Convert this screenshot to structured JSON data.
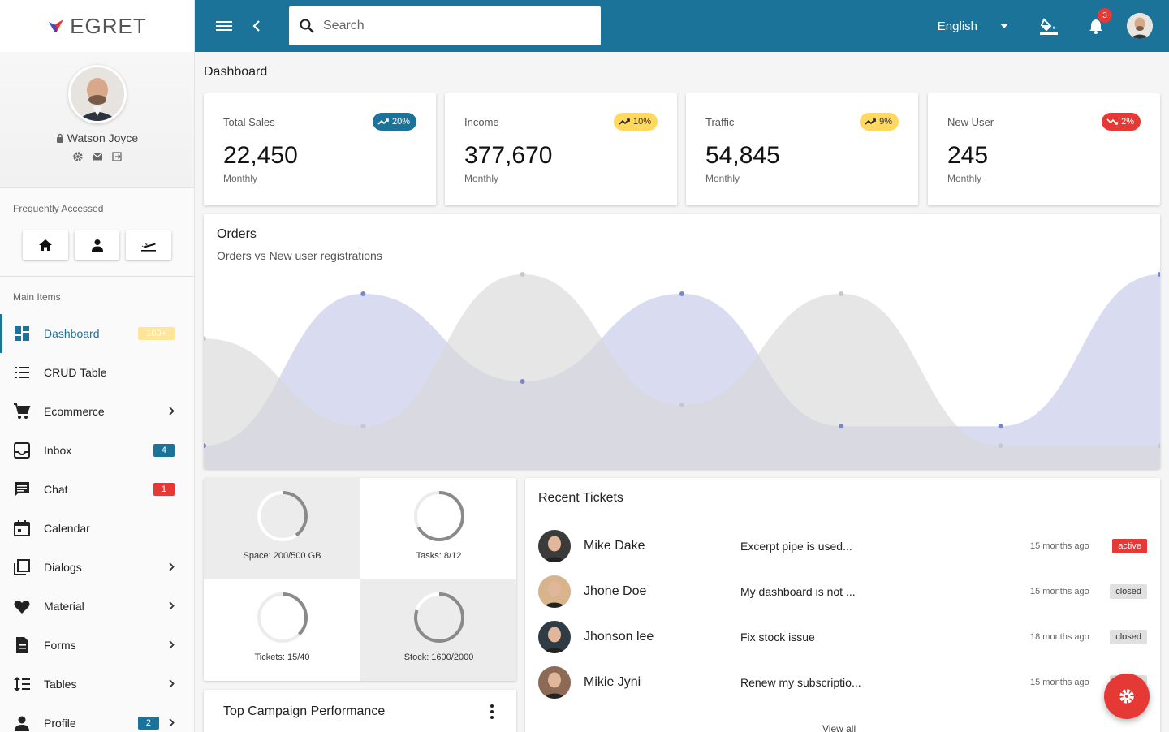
{
  "brand": {
    "name": "EGRET",
    "logo_icon": "egret-logo-icon"
  },
  "user": {
    "name": "Watson Joyce",
    "lock_icon": "lock-icon",
    "actions": [
      "settings-icon",
      "email-icon",
      "logout-icon"
    ]
  },
  "sidebar": {
    "frequently_label": "Frequently Accessed",
    "quick_links": [
      "home-icon",
      "person-icon",
      "flight-icon"
    ],
    "main_label": "Main Items",
    "items": [
      {
        "label": "Dashboard",
        "icon": "dashboard-icon",
        "badge": "100+",
        "badge_color": "yellow",
        "active": true
      },
      {
        "label": "CRUD Table",
        "icon": "list-icon"
      },
      {
        "label": "Ecommerce",
        "icon": "cart-icon",
        "chevron": true
      },
      {
        "label": "Inbox",
        "icon": "inbox-icon",
        "badge": "4",
        "badge_color": "blue"
      },
      {
        "label": "Chat",
        "icon": "chat-icon",
        "badge": "1",
        "badge_color": "red"
      },
      {
        "label": "Calendar",
        "icon": "calendar-icon"
      },
      {
        "label": "Dialogs",
        "icon": "dialogs-icon",
        "chevron": true
      },
      {
        "label": "Material",
        "icon": "heart-icon",
        "chevron": true
      },
      {
        "label": "Forms",
        "icon": "document-icon",
        "chevron": true
      },
      {
        "label": "Tables",
        "icon": "format-line-spacing-icon",
        "chevron": true
      },
      {
        "label": "Profile",
        "icon": "person-icon",
        "badge": "2",
        "badge_color": "blue",
        "chevron": true
      }
    ]
  },
  "topbar": {
    "search_placeholder": "Search",
    "language": "English",
    "notification_count": "3"
  },
  "page": {
    "title": "Dashboard"
  },
  "stats": [
    {
      "title": "Total Sales",
      "value": "22,450",
      "sub": "Monthly",
      "pill": "20%",
      "pill_color": "#1b7399",
      "trend": "up"
    },
    {
      "title": "Income",
      "value": "377,670",
      "sub": "Monthly",
      "pill": "10%",
      "pill_color": "#ffd95e",
      "trend": "up"
    },
    {
      "title": "Traffic",
      "value": "54,845",
      "sub": "Monthly",
      "pill": "9%",
      "pill_color": "#ffd95e",
      "trend": "up"
    },
    {
      "title": "New User",
      "value": "245",
      "sub": "Monthly",
      "pill": "2%",
      "pill_color": "#e53935",
      "trend": "down"
    }
  ],
  "orders": {
    "title": "Orders",
    "subtitle": "Orders vs New user registrations"
  },
  "chart_data": {
    "type": "area",
    "title": "Orders",
    "subtitle": "Orders vs New user registrations",
    "x": [
      0,
      1,
      2,
      3,
      4,
      5,
      6
    ],
    "ylim": [
      0,
      1
    ],
    "grid": false,
    "series": [
      {
        "values": [
          0.12,
          0.9,
          0.45,
          0.9,
          0.22,
          0.22,
          1.0
        ],
        "color": "#c5cae9"
      },
      {
        "values": [
          0.67,
          0.22,
          1.0,
          0.33,
          0.9,
          0.12,
          0.12
        ],
        "color": "#d8d8d8"
      }
    ]
  },
  "gauges": [
    {
      "label": "Space: 200/500 GB",
      "value": 0.4,
      "grey": true
    },
    {
      "label": "Tasks: 8/12",
      "value": 0.67,
      "grey": false
    },
    {
      "label": "Tickets: 15/40",
      "value": 0.375,
      "grey": false
    },
    {
      "label": "Stock: 1600/2000",
      "value": 0.8,
      "grey": true
    }
  ],
  "tickets": {
    "title": "Recent Tickets",
    "rows": [
      {
        "name": "Mike Dake",
        "subject": "Excerpt pipe is used...",
        "time": "15 months ago",
        "status": "active"
      },
      {
        "name": "Jhone Doe",
        "subject": "My dashboard is not ...",
        "time": "15 months ago",
        "status": "closed"
      },
      {
        "name": "Jhonson lee",
        "subject": "Fix stock issue",
        "time": "18 months ago",
        "status": "closed"
      },
      {
        "name": "Mikie Jyni",
        "subject": "Renew my subscriptio...",
        "time": "15 months ago",
        "status": "closed"
      }
    ],
    "view_all": "View all"
  },
  "campaign": {
    "title": "Top Campaign Performance"
  }
}
